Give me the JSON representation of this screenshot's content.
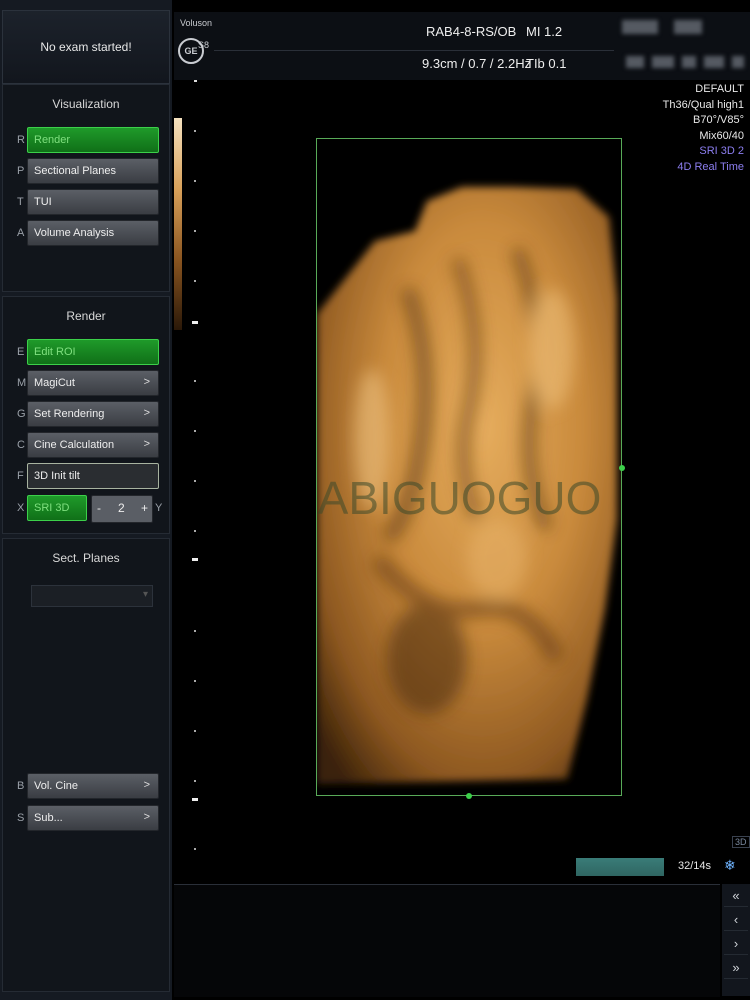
{
  "sidebar": {
    "exam_status": "No exam started!",
    "visualization": {
      "title": "Visualization",
      "items": [
        {
          "key": "R",
          "label": "Render",
          "state": "active"
        },
        {
          "key": "P",
          "label": "Sectional Planes",
          "state": "normal"
        },
        {
          "key": "T",
          "label": "TUI",
          "state": "normal"
        },
        {
          "key": "A",
          "label": "Volume Analysis",
          "state": "normal"
        }
      ]
    },
    "render": {
      "title": "Render",
      "items": [
        {
          "key": "E",
          "label": "Edit ROI",
          "state": "active"
        },
        {
          "key": "M",
          "label": "MagiCut",
          "chevron": ">"
        },
        {
          "key": "G",
          "label": "Set Rendering",
          "chevron": ">"
        },
        {
          "key": "C",
          "label": "Cine Calculation",
          "chevron": ">"
        },
        {
          "key": "F",
          "label": "3D Init tilt",
          "state": "outlined"
        }
      ],
      "sri": {
        "key": "X",
        "label": "SRI 3D",
        "minus": "-",
        "value": "2",
        "plus": "+",
        "right_key": "Y"
      }
    },
    "sect_planes": {
      "title": "Sect. Planes",
      "items": [
        {
          "key": "B",
          "label": "Vol. Cine",
          "chevron": ">"
        },
        {
          "key": "S",
          "label": "Sub...",
          "chevron": ">"
        }
      ]
    }
  },
  "header": {
    "brand": "Voluson",
    "logo": "GE",
    "model": "S8",
    "probe": "RAB4-8-RS/OB",
    "params": "9.3cm / 0.7 / 2.2Hz",
    "mi": "MI  1.2",
    "tib": "TIb  0.1"
  },
  "info": {
    "lines": [
      "DEFAULT",
      "Th36/Qual high1",
      "B70°/V85°",
      "Mix60/40"
    ],
    "highlight_lines": [
      "SRI 3D 2",
      "4D Real Time"
    ],
    "highlight_color": "#8c7ef0"
  },
  "cine": {
    "count": "32/14s",
    "progress": 1.0,
    "view_badge": "3D",
    "freeze_icon": "snowflake-icon"
  },
  "nav": {
    "first": "«",
    "prev": "‹",
    "next": "›",
    "last": "»"
  },
  "watermark": {
    "text": "BABIGUOGUO"
  },
  "colors": {
    "accent_green": "#3cd04a",
    "render_tone": "#c98a3c",
    "cine_bar": "#3a7c78"
  }
}
